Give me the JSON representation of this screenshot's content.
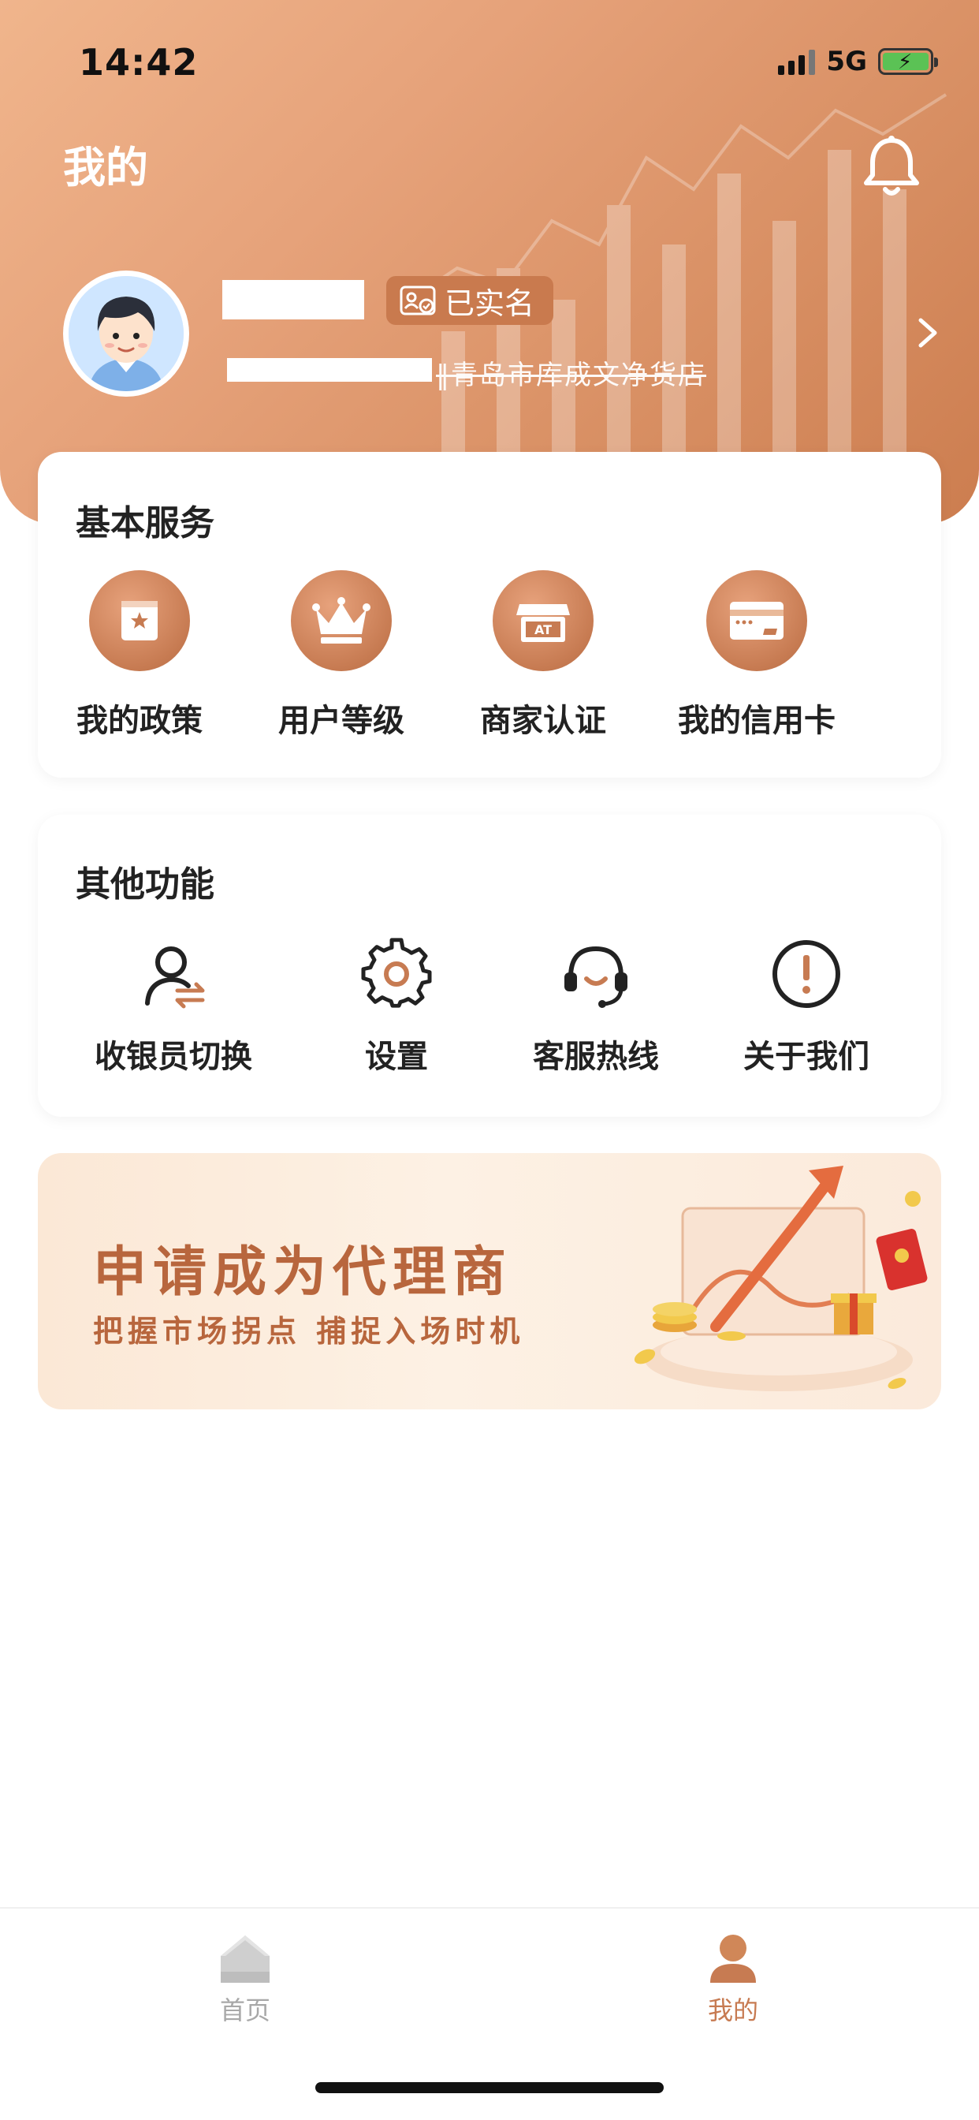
{
  "status_bar": {
    "time": "14:42",
    "network": "5G"
  },
  "header": {
    "title": "我的"
  },
  "profile": {
    "verified_label": "已实名",
    "sub_info_visible": "‖青岛市库成文净货店"
  },
  "basic_services": {
    "title": "基本服务",
    "items": [
      {
        "label": "我的政策",
        "icon": "policy-icon"
      },
      {
        "label": "用户等级",
        "icon": "crown-icon"
      },
      {
        "label": "商家认证",
        "icon": "store-icon"
      },
      {
        "label": "我的信用卡",
        "icon": "credit-card-icon"
      }
    ]
  },
  "other_functions": {
    "title": "其他功能",
    "items": [
      {
        "label": "收银员切换",
        "icon": "cashier-switch-icon"
      },
      {
        "label": "设置",
        "icon": "gear-icon"
      },
      {
        "label": "客服热线",
        "icon": "headset-icon"
      },
      {
        "label": "关于我们",
        "icon": "info-icon"
      }
    ]
  },
  "banner": {
    "title": "申请成为代理商",
    "subtitle": "把握市场拐点 捕捉入场时机"
  },
  "tabbar": {
    "items": [
      {
        "label": "首页",
        "icon": "home-icon",
        "active": false
      },
      {
        "label": "我的",
        "icon": "person-icon",
        "active": true
      }
    ]
  },
  "colors": {
    "accent": "#c77b52",
    "header_gradient_start": "#f0b58c",
    "header_gradient_end": "#cc7d4f",
    "inactive_tab": "#a8a8a8"
  }
}
